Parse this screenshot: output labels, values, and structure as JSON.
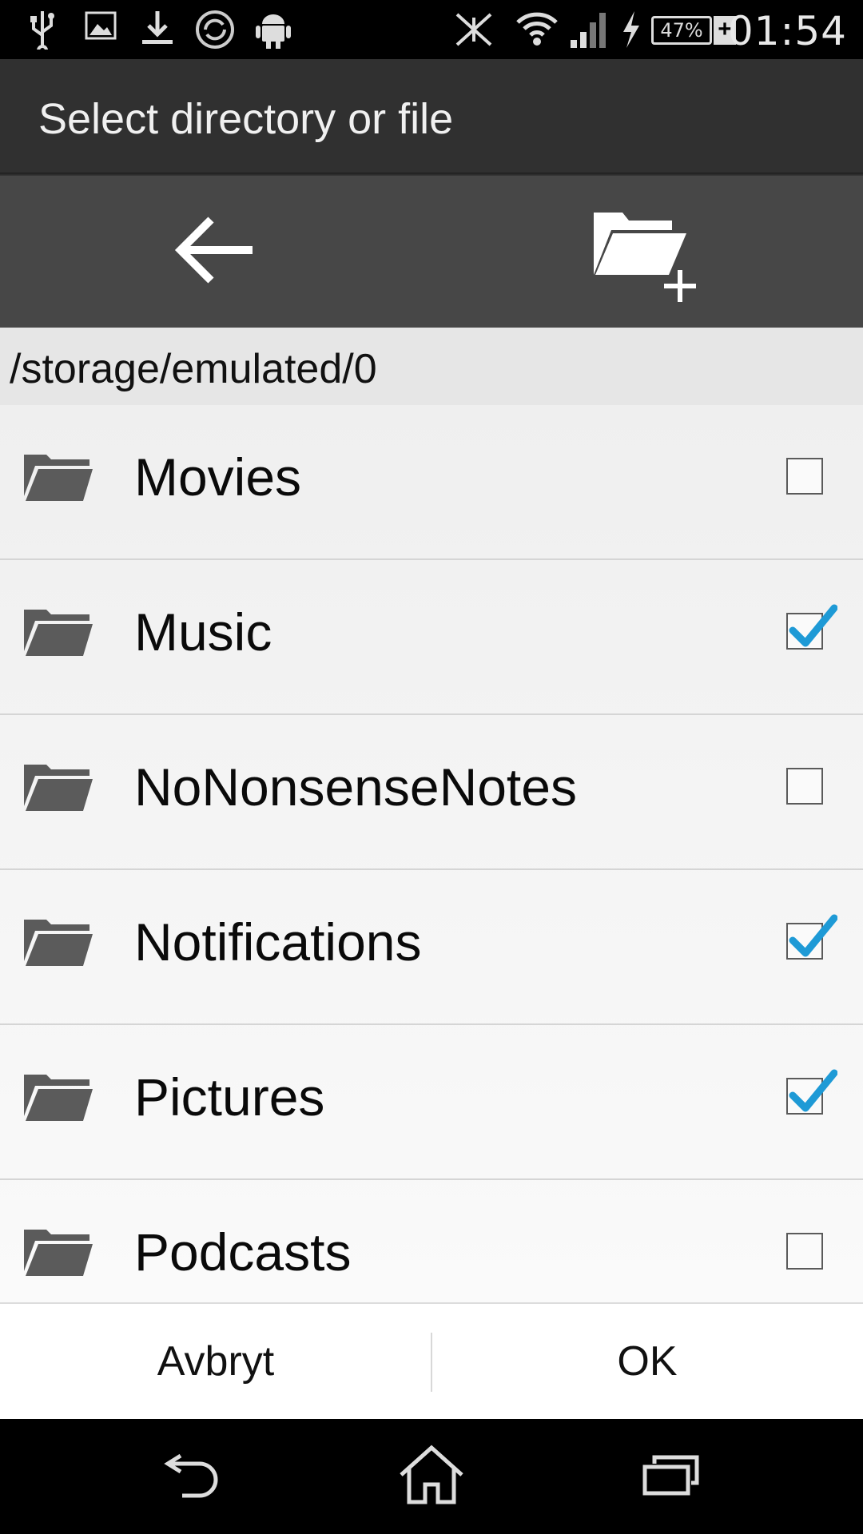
{
  "status_bar": {
    "time": "01:54",
    "battery_percent": "47%",
    "battery_plus": "+",
    "icons": [
      "usb-icon",
      "image-icon",
      "download-icon",
      "sync-icon",
      "android-icon",
      "nfc-off-icon",
      "wifi-icon",
      "signal-icon",
      "charging-icon"
    ]
  },
  "dialog": {
    "title": "Select directory or file"
  },
  "toolbar": {
    "icons": [
      "back-arrow-icon",
      "new-folder-icon"
    ]
  },
  "path": "/storage/emulated/0",
  "folders": [
    {
      "name": "Movies",
      "checked": false
    },
    {
      "name": "Music",
      "checked": true
    },
    {
      "name": "NoNonsenseNotes",
      "checked": false
    },
    {
      "name": "Notifications",
      "checked": true
    },
    {
      "name": "Pictures",
      "checked": true
    },
    {
      "name": "Podcasts",
      "checked": false
    }
  ],
  "actions": {
    "cancel_label": "Avbryt",
    "ok_label": "OK"
  },
  "nav_bar": {
    "icons": [
      "nav-back-icon",
      "nav-home-icon",
      "nav-recents-icon"
    ]
  },
  "colors": {
    "check_accent": "#1e9ad6",
    "folder": "#5b5b5b",
    "toolbar": "#474747",
    "title_bar": "#303030"
  }
}
